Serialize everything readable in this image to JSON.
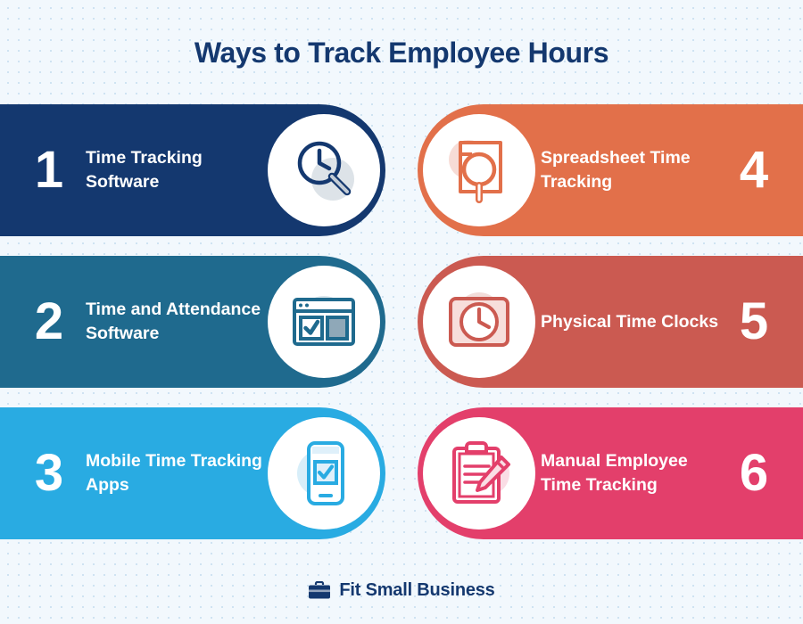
{
  "page": {
    "title": "Ways to Track Employee Hours",
    "background_color": "#f2f8fd",
    "title_color": "#14386f"
  },
  "items": [
    {
      "number": "1",
      "label": "Time Tracking Software",
      "color": "#14386f",
      "side": "left",
      "icon": "clock-magnifier-icon"
    },
    {
      "number": "2",
      "label": "Time and Attendance Software",
      "color": "#1f6a8e",
      "side": "left",
      "icon": "browser-checkbox-icon"
    },
    {
      "number": "3",
      "label": "Mobile Time Tracking Apps",
      "color": "#29abe2",
      "side": "left",
      "icon": "mobile-checkbox-icon"
    },
    {
      "number": "4",
      "label": "Spreadsheet Time Tracking",
      "color": "#e2704a",
      "side": "right",
      "icon": "document-magnifier-icon"
    },
    {
      "number": "5",
      "label": "Physical Time Clocks",
      "color": "#cb5a51",
      "side": "right",
      "icon": "time-clock-icon"
    },
    {
      "number": "6",
      "label": "Manual Employee Time Tracking",
      "color": "#e33f6b",
      "side": "right",
      "icon": "clipboard-pencil-icon"
    }
  ],
  "footer": {
    "brand": "Fit Small Business",
    "icon": "briefcase-icon",
    "color": "#14386f"
  }
}
